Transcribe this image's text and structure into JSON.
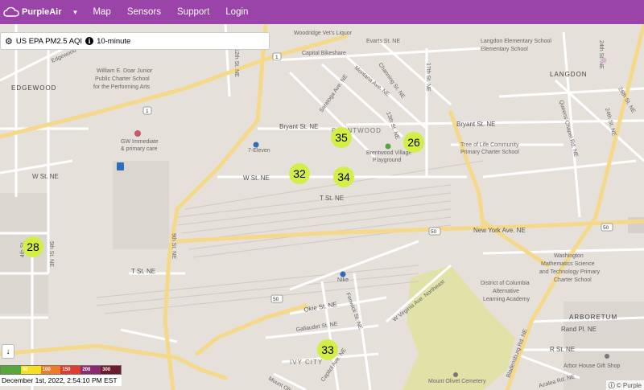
{
  "navbar": {
    "brand": "PurpleAir",
    "links": [
      "Map",
      "Sensors",
      "Support",
      "Login"
    ]
  },
  "sensor_selector": {
    "label": "US EPA PM2.5 AQI",
    "period": "10-minute"
  },
  "markers": [
    {
      "value": "35"
    },
    {
      "value": "26"
    },
    {
      "value": "32"
    },
    {
      "value": "34"
    },
    {
      "value": "28"
    },
    {
      "value": "33"
    }
  ],
  "legend": {
    "labels": [
      "",
      "50",
      "100",
      "150",
      "200",
      "300"
    ],
    "colors": [
      "#56a83b",
      "#f5e020",
      "#f07b24",
      "#e23b2f",
      "#8e2a6f",
      "#6d1a2a"
    ]
  },
  "timestamp": "December 1st, 2022, 2:54:10 PM EST",
  "attribution": "© Purple",
  "map_labels": {
    "woodridge": "Woodridge Vet's Liquor",
    "evarts": "Evarts St. NE",
    "langdon_school": "Langdon Elementary School",
    "st24": "24th St. NE",
    "edgewood": "Edgewood",
    "edgewood_area": "EDGEWOOD",
    "capital_bikeshare": "Capital Bikeshare",
    "channing": "Channing St. NE",
    "montana": "Montana Ave. NE",
    "st17": "17th St. NE",
    "langdon_area": "LANGDON",
    "dejoy": "William E. Doar Junior",
    "dejoy2": "Public Charter School",
    "dejoy3": "for the Performing Arts",
    "st12": "12th St. NE",
    "saratoga": "Saratoga Ave. NE",
    "st13": "13th St. NE",
    "queens_chapel": "Queens Chapel Rd. NE",
    "st26": "26th St. NE",
    "gw": "GW Immediate",
    "gw2": "& primary care",
    "bryant_w": "Bryant St. NE",
    "brentwood": "BRENTWOOD",
    "bryant_e": "Bryant St. NE",
    "tree_of_life": "Tree of Life Community",
    "tree_of_life2": "Primary Charter School",
    "mills": "24th St. NE",
    "seven_eleven": "7-Eleven",
    "brentwood_village": "Brentwood Village",
    "brentwood_village2": "Playground",
    "w_st_left": "W St. NE",
    "w_st": "W St. NE",
    "t_st": "T St. NE",
    "r50": "50",
    "new_york": "New York Ave. NE",
    "st4": "4th St.",
    "st5": "5th St. NE",
    "st9": "9th St. NE",
    "t_st_left": "T St. NE",
    "washington_school": "Washington",
    "washington_school2": "Mathematics Science",
    "washington_school3": "and Technology Primary",
    "washington_school4": "Charter School",
    "nike": "Nike",
    "dc_school": "District of Columbia",
    "dc_school2": "Alternative",
    "dc_school3": "Learning Academy",
    "west_virginia": "W Virginia Ave. Northeast",
    "arboretum": "ARBORETUM",
    "rand": "Rand Pl. NE",
    "okie": "Okie St. NE",
    "fenwick": "Fenwick St. NE",
    "gallaudet": "Gallaudet St. NE",
    "r_st": "R St. NE",
    "ivy_city": "IVY CITY",
    "capitol_ave": "Capitol Ave. NE",
    "mount_olivet_cem": "Mount Olivet Cemetery",
    "bladensburg": "Bladensburg Rd. NE",
    "arbor_house": "Arbor House Gift Shop",
    "azalea": "Azalea Rd. NE",
    "mount_olivet": "Mount Olivet"
  }
}
